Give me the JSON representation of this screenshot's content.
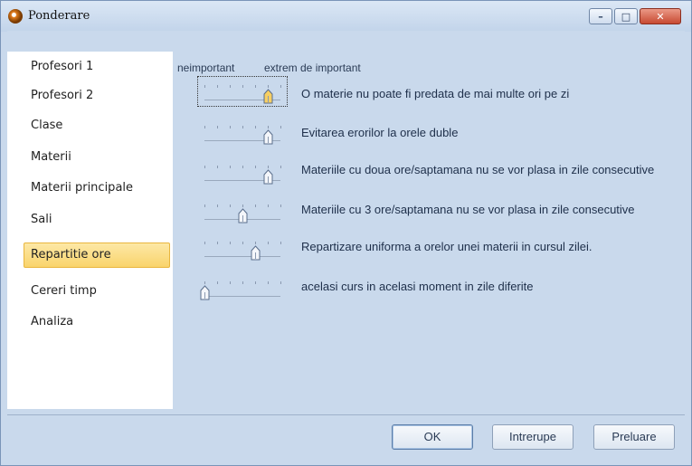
{
  "window": {
    "title": "Ponderare",
    "minimize_glyph": "–",
    "maximize_glyph": "□",
    "close_glyph": "✕"
  },
  "sidebar": {
    "items": [
      {
        "label": "Profesori 1",
        "active": false
      },
      {
        "label": "Profesori 2",
        "active": false
      },
      {
        "label": "Clase",
        "active": false
      },
      {
        "label": "Materii",
        "active": false
      },
      {
        "label": "Materii principale",
        "active": false
      },
      {
        "label": "Sali",
        "active": false
      },
      {
        "label": "Repartitie ore",
        "active": true
      },
      {
        "label": "Cereri timp",
        "active": false
      },
      {
        "label": "Analiza",
        "active": false
      }
    ]
  },
  "scale": {
    "min_label": "neimportant",
    "max_label": "extrem de important"
  },
  "constraints": [
    {
      "label": "O materie nu poate fi predata de mai multe ori pe zi",
      "level_fraction": 0.83,
      "focused": true
    },
    {
      "label": "Evitarea erorilor la orele duble",
      "level_fraction": 0.83,
      "focused": false
    },
    {
      "label": "Materiile cu doua ore/saptamana nu se vor plasa in zile consecutive",
      "level_fraction": 0.83,
      "focused": false
    },
    {
      "label": "Materiile cu 3 ore/saptamana nu se vor plasa in zile consecutive",
      "level_fraction": 0.5,
      "focused": false
    },
    {
      "label": "Repartizare uniforma a orelor unei materii in cursul zilei.",
      "level_fraction": 0.67,
      "focused": false
    },
    {
      "label": "acelasi  curs in acelasi moment in zile diferite",
      "level_fraction": 0.0,
      "focused": false
    }
  ],
  "buttons": {
    "ok": "OK",
    "cancel": "Intrerupe",
    "apply": "Preluare"
  },
  "colors": {
    "accent": "#f9d46c",
    "panel_bg": "#c9d9ec"
  }
}
